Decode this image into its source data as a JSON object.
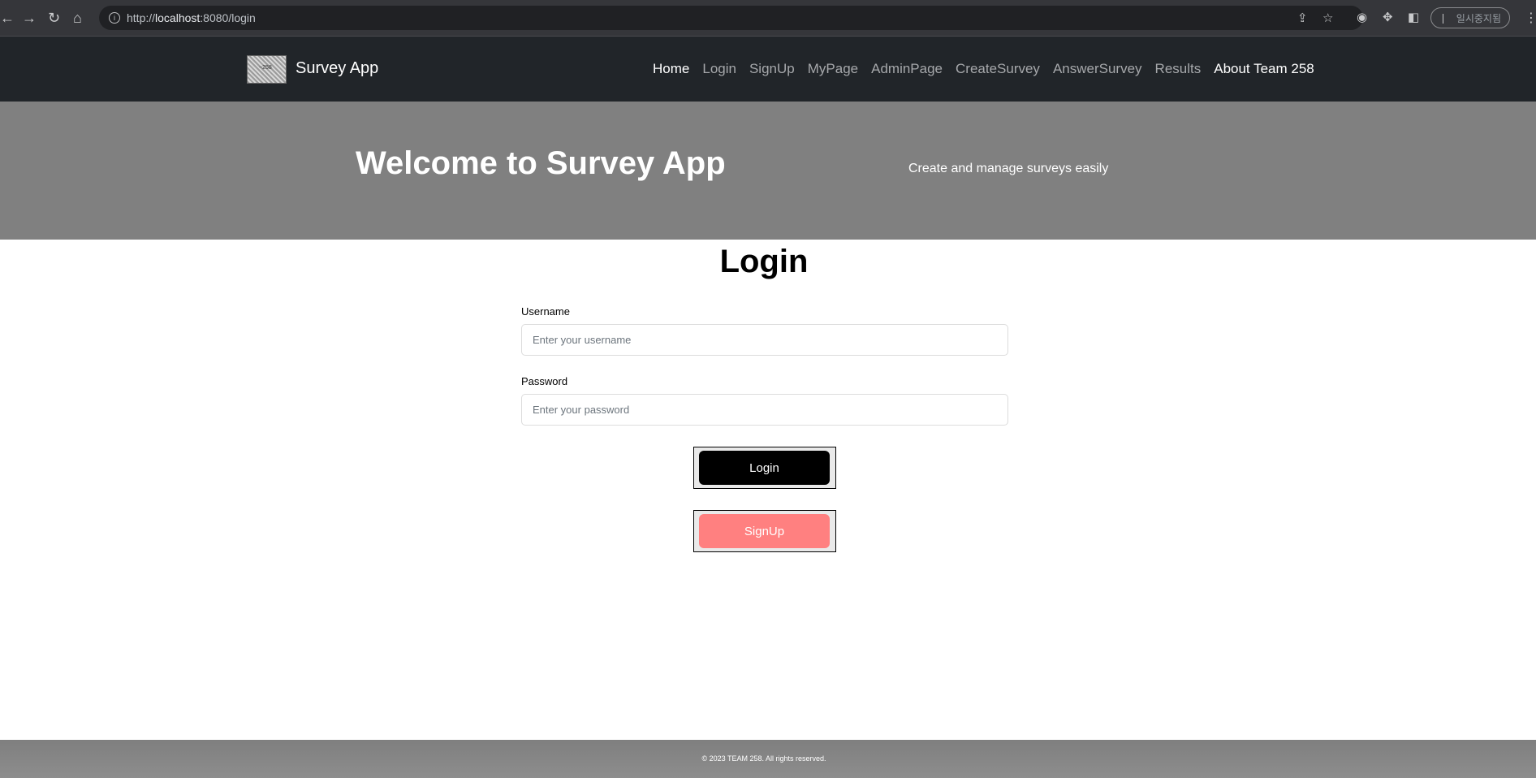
{
  "browser": {
    "url_prefix": "http://",
    "url_host": "localhost",
    "url_path": ":8080/login",
    "profile_label": "일시중지됨",
    "icons": [
      "back-icon",
      "forward-icon",
      "reload-icon",
      "home-icon",
      "site-info-icon",
      "share-icon",
      "bookmark-star-icon",
      "extension-icon",
      "puzzle-icon",
      "sidebar-icon",
      "menu-kebab-icon"
    ]
  },
  "navbar": {
    "brand": "Survey App",
    "links": [
      {
        "label": "Home",
        "active": true
      },
      {
        "label": "Login",
        "active": false
      },
      {
        "label": "SignUp",
        "active": false
      },
      {
        "label": "MyPage",
        "active": false
      },
      {
        "label": "AdminPage",
        "active": false
      },
      {
        "label": "CreateSurvey",
        "active": false
      },
      {
        "label": "AnswerSurvey",
        "active": false
      },
      {
        "label": "Results",
        "active": false
      },
      {
        "label": "About Team 258",
        "active": true
      }
    ]
  },
  "hero": {
    "title": "Welcome to Survey App",
    "subtitle": "Create and manage surveys easily"
  },
  "login": {
    "title": "Login",
    "username_label": "Username",
    "username_placeholder": "Enter your username",
    "username_value": "",
    "password_label": "Password",
    "password_placeholder": "Enter your password",
    "password_value": "",
    "login_button": "Login",
    "signup_button": "SignUp"
  },
  "footer": {
    "copyright": "© 2023 TEAM 258. All rights reserved."
  },
  "colors": {
    "navbar_bg": "#212529",
    "hero_bg": "#808080",
    "login_button_bg": "#000000",
    "signup_button_bg": "#ff8080",
    "footer_bg": "#808080"
  }
}
